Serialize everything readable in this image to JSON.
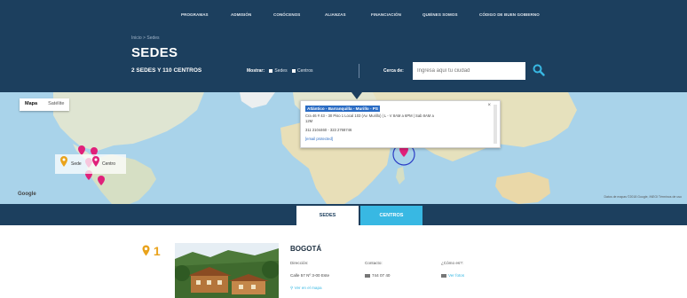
{
  "nav": {
    "items": [
      "PROGRAMAS",
      "ADMISIÓN",
      "CONÓCENOS",
      "ALIANZAS",
      "FINANCIACIÓN",
      "QUIÉNES SOMOS",
      "CÓDIGO DE BUEN GOBIERNO"
    ]
  },
  "header": {
    "breadcrumb": "Inicio > Sedes",
    "title": "SEDES",
    "subtitle": "2 SEDES Y 110 CENTROS",
    "show_label": "Mostrar:",
    "show_sedes": "Sedes",
    "show_centros": "Centros",
    "near_label": "Cerca de:",
    "search_placeholder": "Ingresa aquí tu ciudad"
  },
  "map": {
    "tab_map": "Mapa",
    "tab_satellite": "Satélite",
    "legend_sede": "Sede",
    "legend_centro": "Centro",
    "google": "Google",
    "footer": "Datos de mapas ©2018 Google, INEGI  Términos de uso",
    "popup": {
      "title": "Atlántico - Barranquilla - Murillo - PS",
      "line1": "Cra 46 # 43 - 30 Piso 1 Local 103 (Av. Murillo) | L - V 8AM a 6PM | Sab 8AM a",
      "line2": "12M",
      "line3": "311 2104460 - 323 2768746",
      "line4": "[email protected]"
    }
  },
  "tabs": {
    "sedes": "SEDES",
    "centros": "CENTROS"
  },
  "content": {
    "number": "1",
    "city": "BOGOTÁ",
    "direccion_label": "Dirección:",
    "direccion_value": "Calle 57 Nº 3-00 Este",
    "contacto_label": "Contacto:",
    "contacto_value": "744 07 40",
    "como_label": "¿Cómo es?:",
    "como_value": "Ver fotos",
    "map_link": "Ver en el mapa"
  },
  "colors": {
    "header_bg": "#1c3f5e",
    "accent": "#38b8e3",
    "marker": "#e0207a",
    "sede_marker": "#e9a31c"
  }
}
